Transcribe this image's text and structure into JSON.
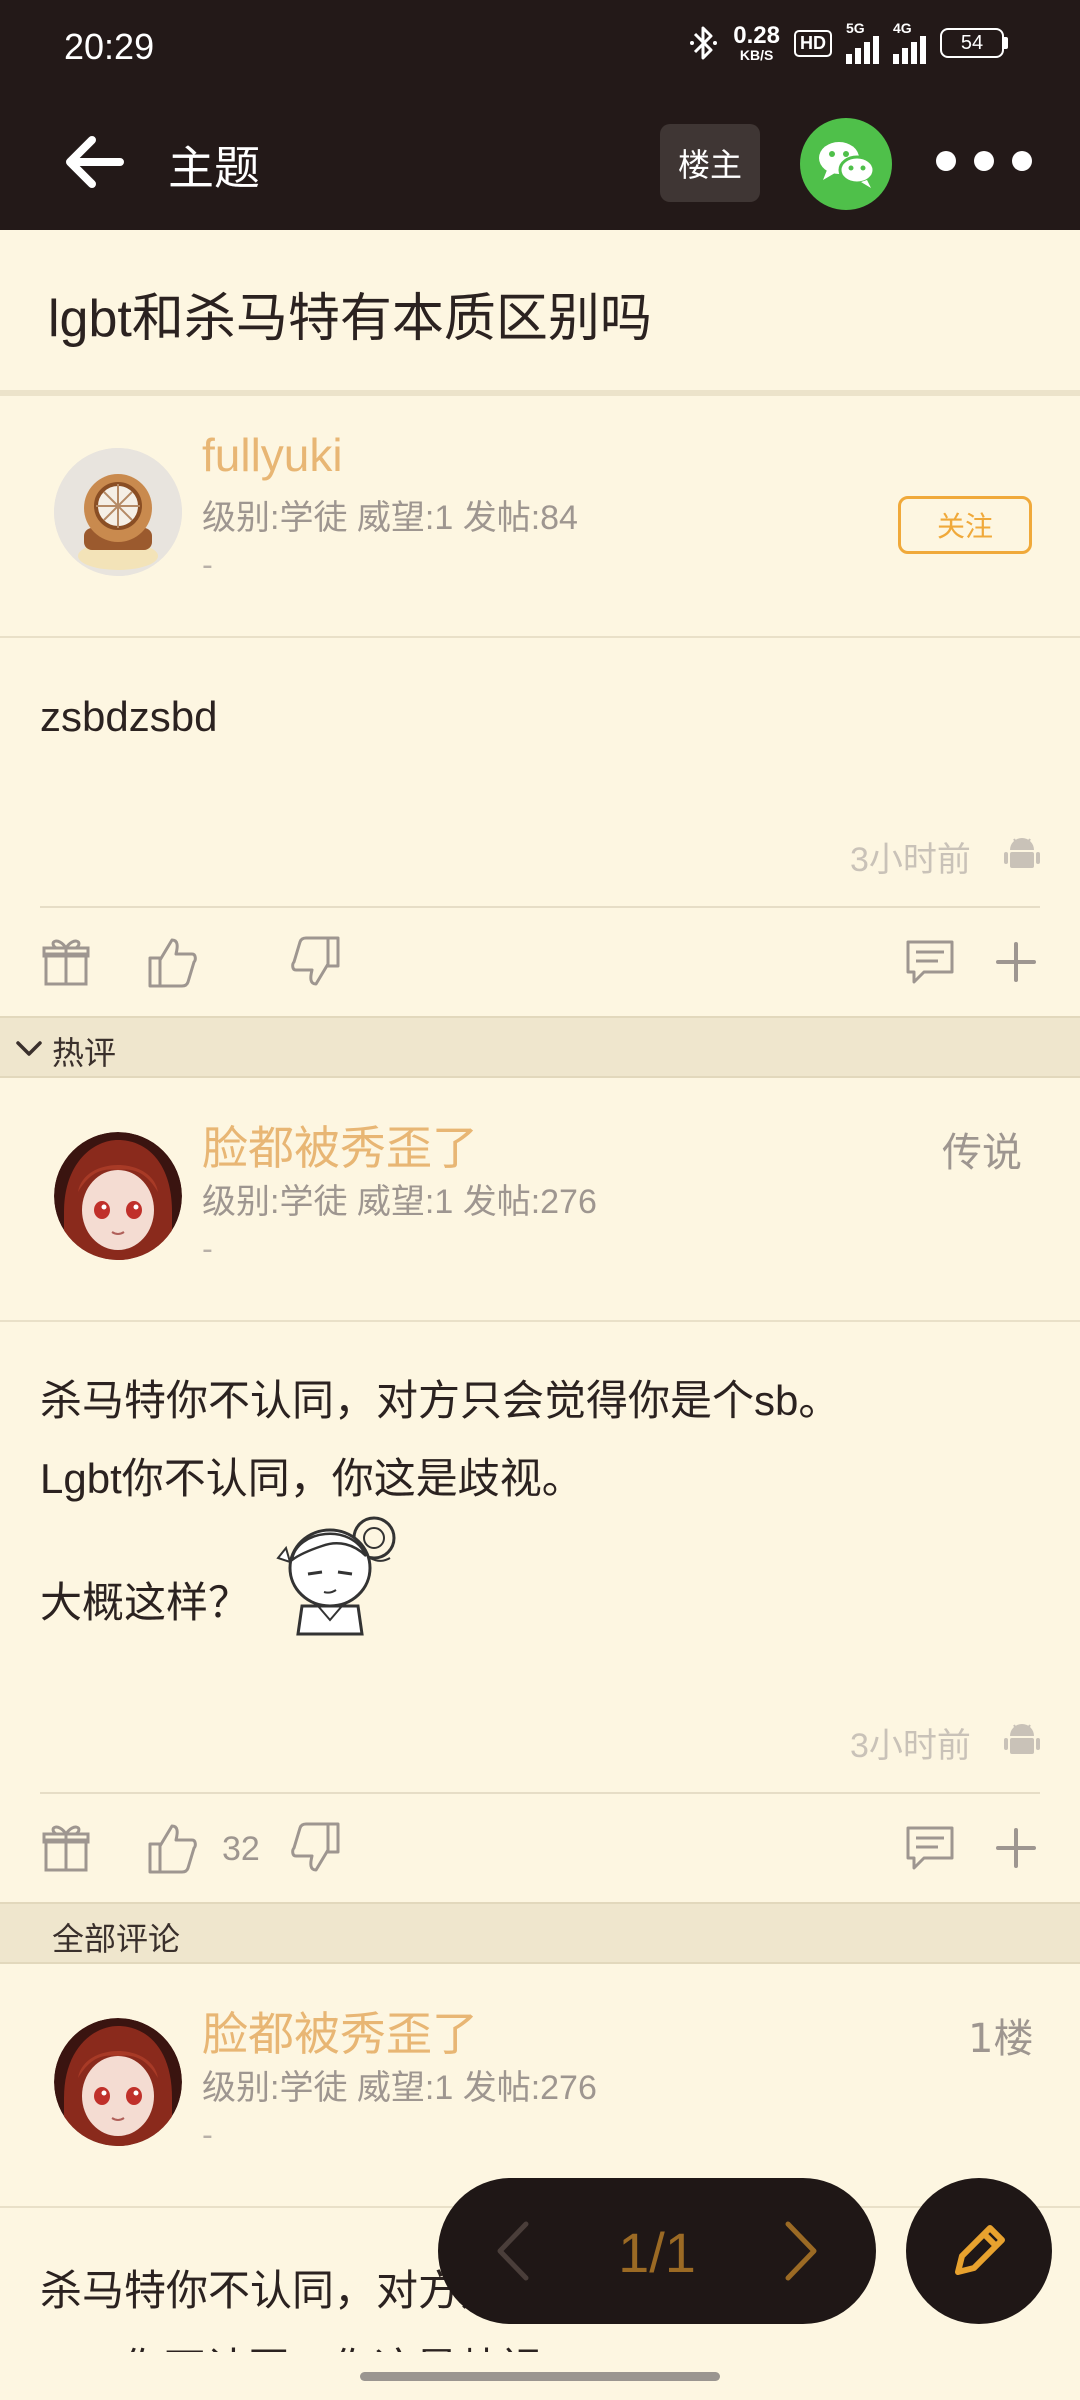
{
  "status_bar": {
    "time": "20:29",
    "net_speed_value": "0.28",
    "net_speed_unit": "KB/S",
    "hd": "HD",
    "sig1_label": "5G",
    "sig2_label": "4G",
    "battery": "54"
  },
  "app_bar": {
    "title": "主题",
    "op_button": "楼主"
  },
  "thread": {
    "title": "lgbt和杀马特有本质区别吗"
  },
  "op_post": {
    "username": "fullyuki",
    "info": "级别:学徒 威望:1 发帖:84",
    "dash": "-",
    "follow_label": "关注",
    "content": "zsbdzsbd",
    "time": "3小时前"
  },
  "hot_section": {
    "label": "热评"
  },
  "hot_comment": {
    "username": "脸都被秀歪了",
    "rank": "传说",
    "info": "级别:学徒 威望:1 发帖:276",
    "dash": "-",
    "line1": "杀马特你不认同，对方只会觉得你是个sb。",
    "line2": "Lgbt你不认同，你这是歧视。",
    "line3": "大概这样？",
    "time": "3小时前",
    "likes": "32"
  },
  "all_section": {
    "label": "全部评论"
  },
  "floor1": {
    "username": "脸都被秀歪了",
    "floor": "1楼",
    "info": "级别:学徒 威望:1 发帖:276",
    "dash": "-",
    "line1": "杀马特你不认同，对方只会觉得你是个sb。",
    "line2": "Lgbt你不认同，你这是歧视。"
  },
  "pager": {
    "text": "1/1"
  },
  "colors": {
    "background": "#fdf6e1",
    "header": "#231918",
    "username": "#e8b674",
    "follow": "#f0a93a",
    "wechat": "#4fc04a"
  }
}
